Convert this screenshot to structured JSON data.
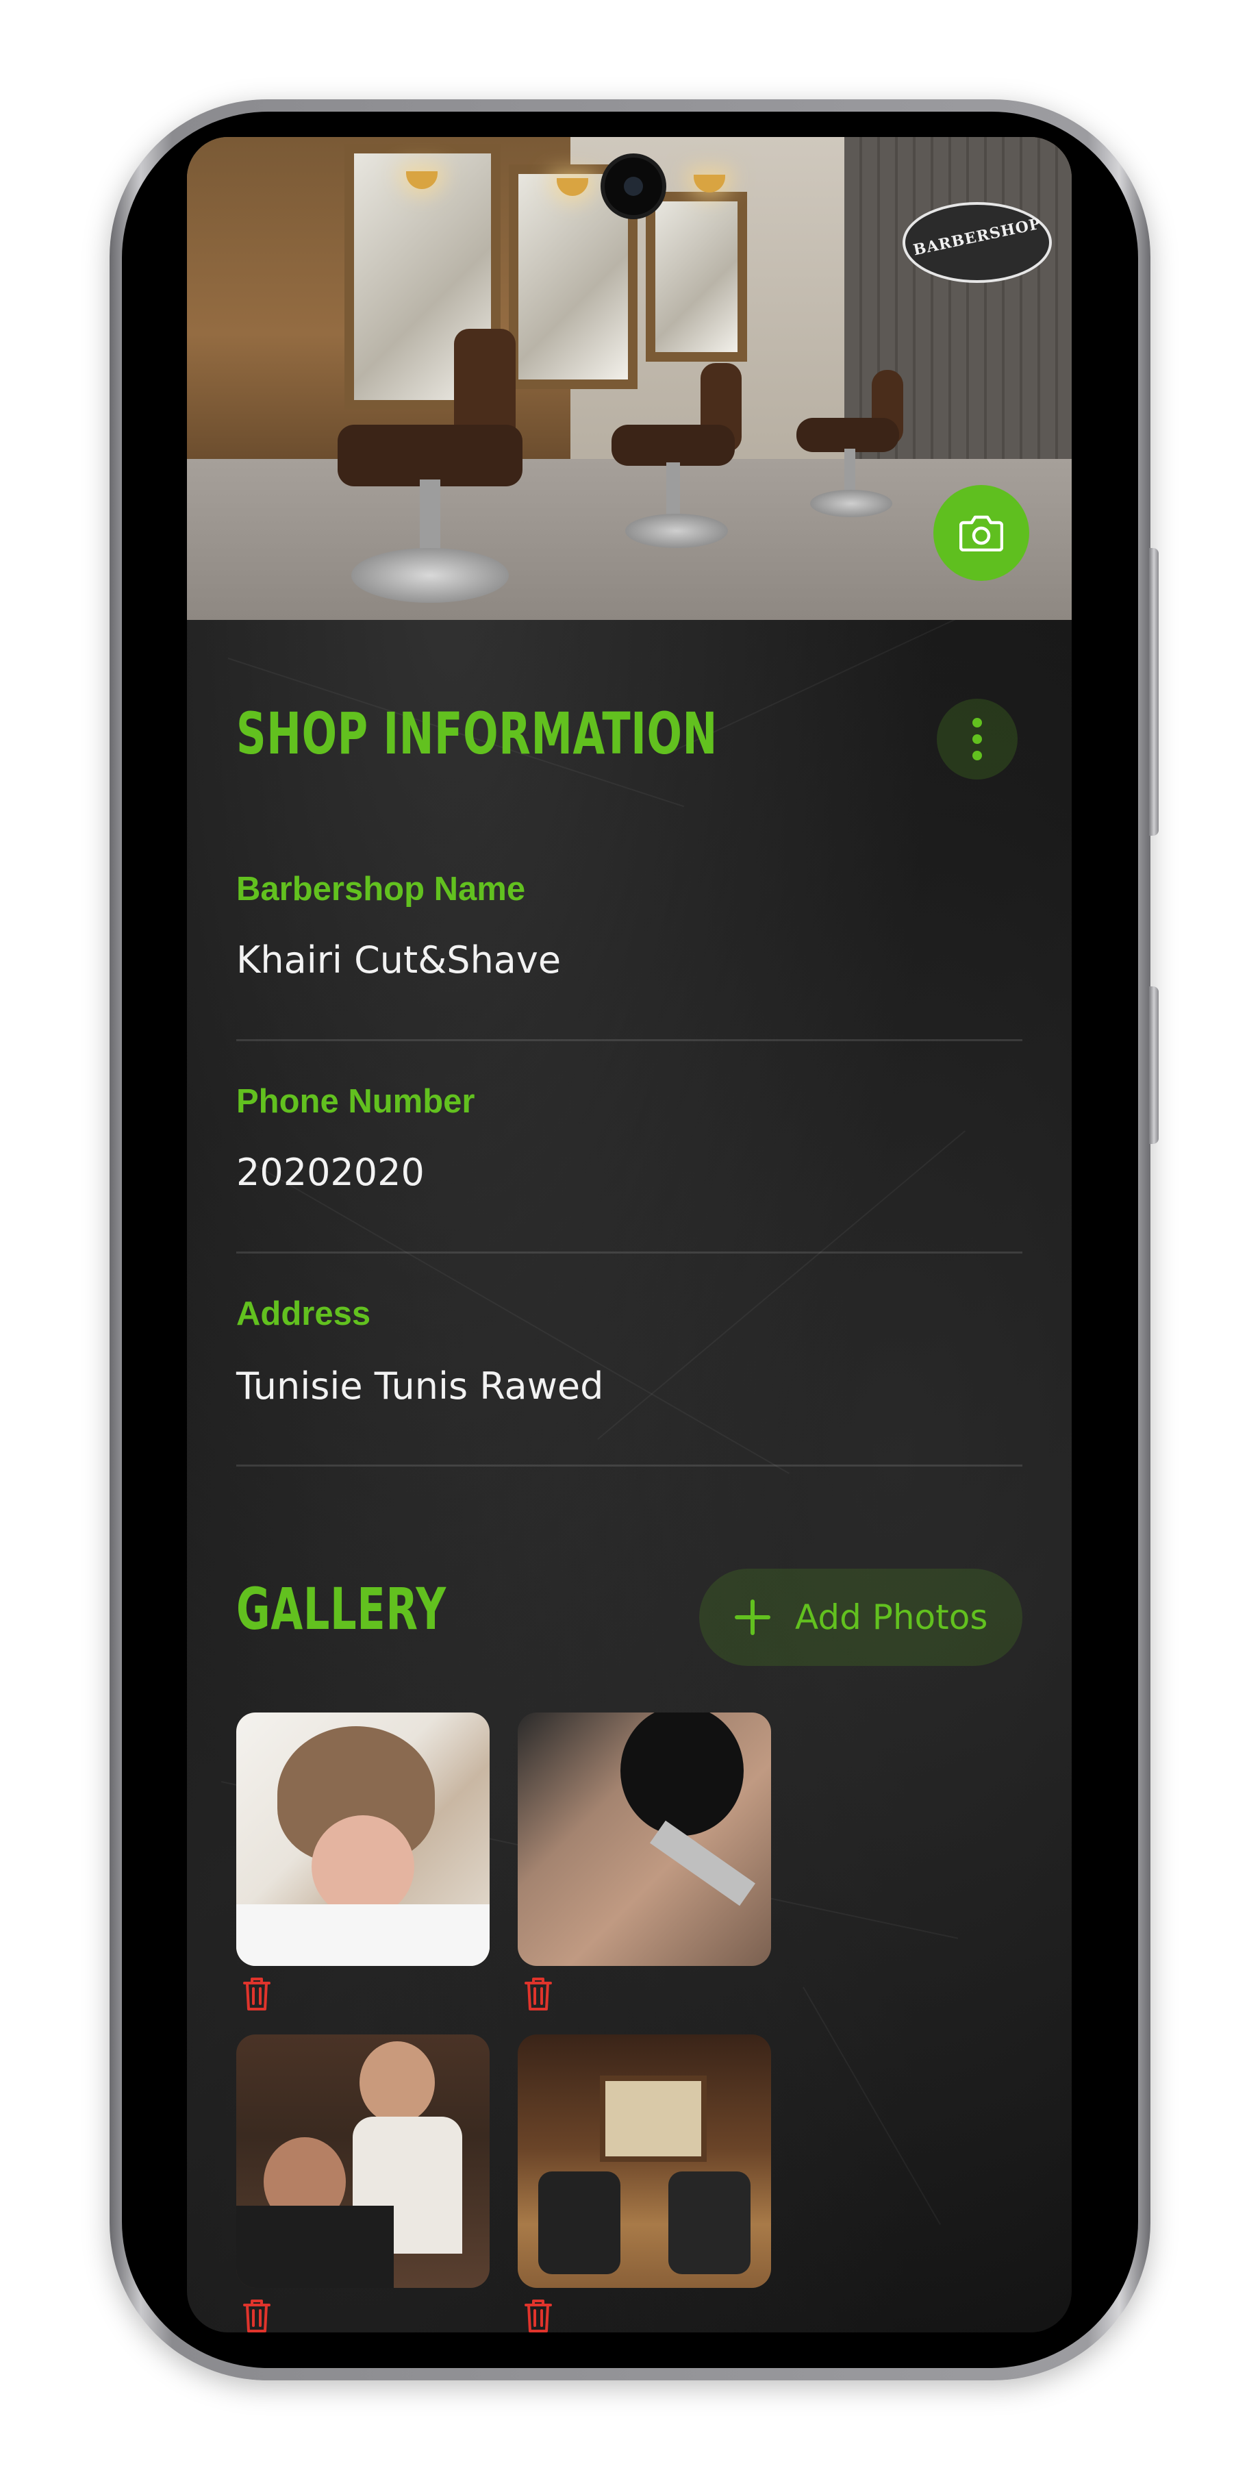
{
  "hero": {
    "sign_text": "BARBERSHOP"
  },
  "shop_info": {
    "title": "SHOP INFORMATION",
    "fields": [
      {
        "label": "Barbershop Name",
        "value": "Khairi Cut&Shave"
      },
      {
        "label": "Phone Number",
        "value": "20202020"
      },
      {
        "label": "Address",
        "value": "Tunisie Tunis Rawed"
      }
    ]
  },
  "gallery": {
    "title": "GALLERY",
    "add_label": "Add Photos",
    "photos": [
      {
        "icon": "delete-icon"
      },
      {
        "icon": "delete-icon"
      },
      {
        "icon": "delete-icon"
      },
      {
        "icon": "delete-icon"
      }
    ]
  },
  "colors": {
    "accent": "#62c11f",
    "delete": "#e0342c",
    "background": "#151515"
  }
}
